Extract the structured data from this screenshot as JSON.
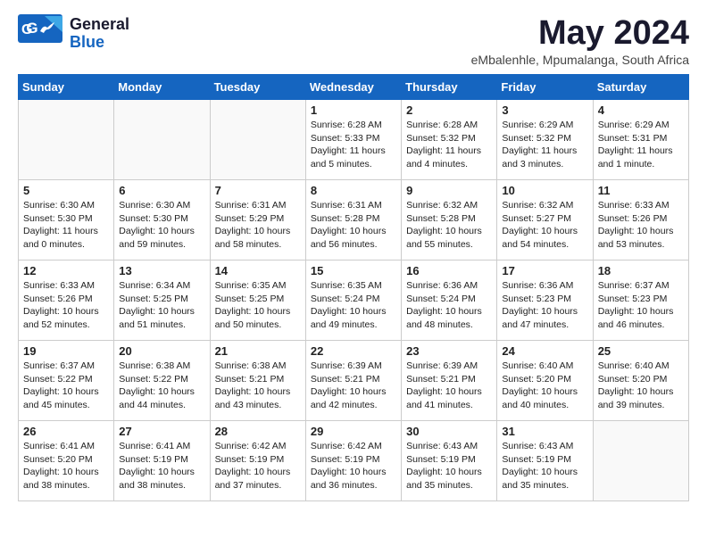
{
  "header": {
    "logo_general": "General",
    "logo_blue": "Blue",
    "month_title": "May 2024",
    "location": "eMbalenhle, Mpumalanga, South Africa"
  },
  "weekdays": [
    "Sunday",
    "Monday",
    "Tuesday",
    "Wednesday",
    "Thursday",
    "Friday",
    "Saturday"
  ],
  "weeks": [
    [
      {
        "day": "",
        "info": ""
      },
      {
        "day": "",
        "info": ""
      },
      {
        "day": "",
        "info": ""
      },
      {
        "day": "1",
        "info": "Sunrise: 6:28 AM\nSunset: 5:33 PM\nDaylight: 11 hours\nand 5 minutes."
      },
      {
        "day": "2",
        "info": "Sunrise: 6:28 AM\nSunset: 5:32 PM\nDaylight: 11 hours\nand 4 minutes."
      },
      {
        "day": "3",
        "info": "Sunrise: 6:29 AM\nSunset: 5:32 PM\nDaylight: 11 hours\nand 3 minutes."
      },
      {
        "day": "4",
        "info": "Sunrise: 6:29 AM\nSunset: 5:31 PM\nDaylight: 11 hours\nand 1 minute."
      }
    ],
    [
      {
        "day": "5",
        "info": "Sunrise: 6:30 AM\nSunset: 5:30 PM\nDaylight: 11 hours\nand 0 minutes."
      },
      {
        "day": "6",
        "info": "Sunrise: 6:30 AM\nSunset: 5:30 PM\nDaylight: 10 hours\nand 59 minutes."
      },
      {
        "day": "7",
        "info": "Sunrise: 6:31 AM\nSunset: 5:29 PM\nDaylight: 10 hours\nand 58 minutes."
      },
      {
        "day": "8",
        "info": "Sunrise: 6:31 AM\nSunset: 5:28 PM\nDaylight: 10 hours\nand 56 minutes."
      },
      {
        "day": "9",
        "info": "Sunrise: 6:32 AM\nSunset: 5:28 PM\nDaylight: 10 hours\nand 55 minutes."
      },
      {
        "day": "10",
        "info": "Sunrise: 6:32 AM\nSunset: 5:27 PM\nDaylight: 10 hours\nand 54 minutes."
      },
      {
        "day": "11",
        "info": "Sunrise: 6:33 AM\nSunset: 5:26 PM\nDaylight: 10 hours\nand 53 minutes."
      }
    ],
    [
      {
        "day": "12",
        "info": "Sunrise: 6:33 AM\nSunset: 5:26 PM\nDaylight: 10 hours\nand 52 minutes."
      },
      {
        "day": "13",
        "info": "Sunrise: 6:34 AM\nSunset: 5:25 PM\nDaylight: 10 hours\nand 51 minutes."
      },
      {
        "day": "14",
        "info": "Sunrise: 6:35 AM\nSunset: 5:25 PM\nDaylight: 10 hours\nand 50 minutes."
      },
      {
        "day": "15",
        "info": "Sunrise: 6:35 AM\nSunset: 5:24 PM\nDaylight: 10 hours\nand 49 minutes."
      },
      {
        "day": "16",
        "info": "Sunrise: 6:36 AM\nSunset: 5:24 PM\nDaylight: 10 hours\nand 48 minutes."
      },
      {
        "day": "17",
        "info": "Sunrise: 6:36 AM\nSunset: 5:23 PM\nDaylight: 10 hours\nand 47 minutes."
      },
      {
        "day": "18",
        "info": "Sunrise: 6:37 AM\nSunset: 5:23 PM\nDaylight: 10 hours\nand 46 minutes."
      }
    ],
    [
      {
        "day": "19",
        "info": "Sunrise: 6:37 AM\nSunset: 5:22 PM\nDaylight: 10 hours\nand 45 minutes."
      },
      {
        "day": "20",
        "info": "Sunrise: 6:38 AM\nSunset: 5:22 PM\nDaylight: 10 hours\nand 44 minutes."
      },
      {
        "day": "21",
        "info": "Sunrise: 6:38 AM\nSunset: 5:21 PM\nDaylight: 10 hours\nand 43 minutes."
      },
      {
        "day": "22",
        "info": "Sunrise: 6:39 AM\nSunset: 5:21 PM\nDaylight: 10 hours\nand 42 minutes."
      },
      {
        "day": "23",
        "info": "Sunrise: 6:39 AM\nSunset: 5:21 PM\nDaylight: 10 hours\nand 41 minutes."
      },
      {
        "day": "24",
        "info": "Sunrise: 6:40 AM\nSunset: 5:20 PM\nDaylight: 10 hours\nand 40 minutes."
      },
      {
        "day": "25",
        "info": "Sunrise: 6:40 AM\nSunset: 5:20 PM\nDaylight: 10 hours\nand 39 minutes."
      }
    ],
    [
      {
        "day": "26",
        "info": "Sunrise: 6:41 AM\nSunset: 5:20 PM\nDaylight: 10 hours\nand 38 minutes."
      },
      {
        "day": "27",
        "info": "Sunrise: 6:41 AM\nSunset: 5:19 PM\nDaylight: 10 hours\nand 38 minutes."
      },
      {
        "day": "28",
        "info": "Sunrise: 6:42 AM\nSunset: 5:19 PM\nDaylight: 10 hours\nand 37 minutes."
      },
      {
        "day": "29",
        "info": "Sunrise: 6:42 AM\nSunset: 5:19 PM\nDaylight: 10 hours\nand 36 minutes."
      },
      {
        "day": "30",
        "info": "Sunrise: 6:43 AM\nSunset: 5:19 PM\nDaylight: 10 hours\nand 35 minutes."
      },
      {
        "day": "31",
        "info": "Sunrise: 6:43 AM\nSunset: 5:19 PM\nDaylight: 10 hours\nand 35 minutes."
      },
      {
        "day": "",
        "info": ""
      }
    ]
  ]
}
